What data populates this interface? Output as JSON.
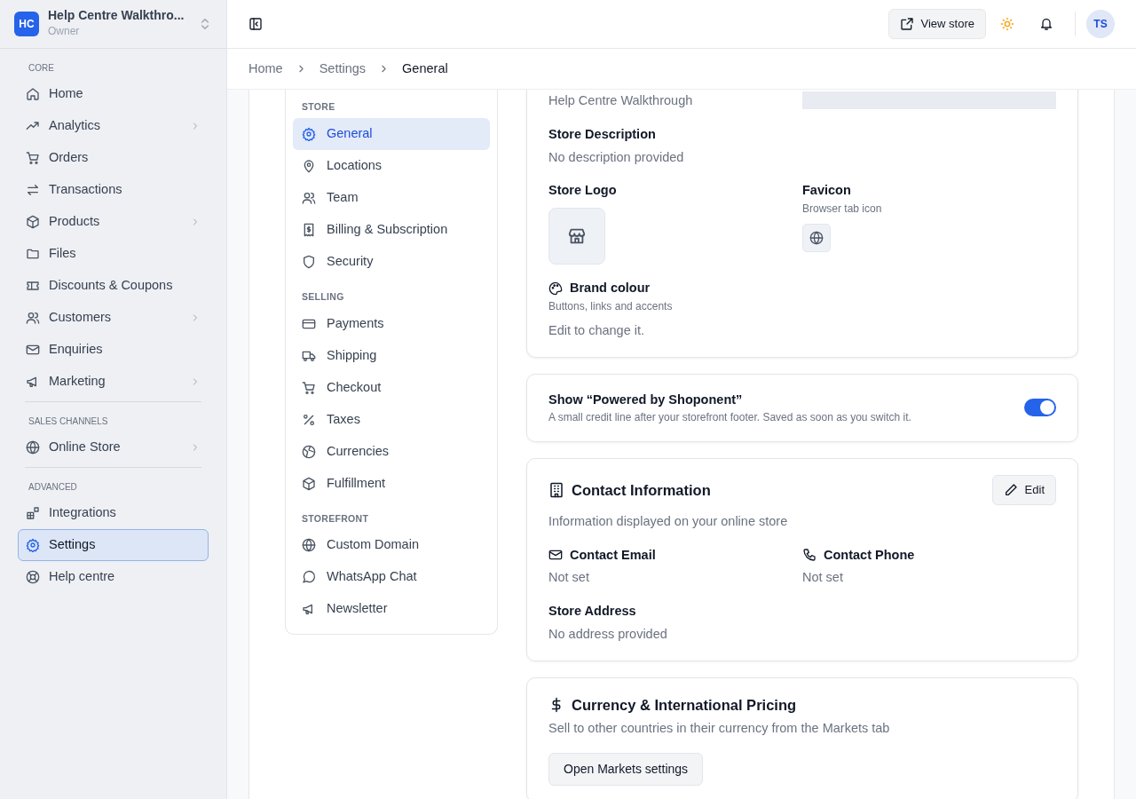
{
  "store_switcher": {
    "initials": "HC",
    "name": "Help Centre Walkthro...",
    "role": "Owner"
  },
  "sidebar": {
    "sections": [
      {
        "title": "CORE",
        "items": [
          {
            "label": "Home",
            "has_children": false,
            "selected": false
          },
          {
            "label": "Analytics",
            "has_children": true,
            "selected": false
          },
          {
            "label": "Orders",
            "has_children": false,
            "selected": false
          },
          {
            "label": "Transactions",
            "has_children": false,
            "selected": false
          },
          {
            "label": "Products",
            "has_children": true,
            "selected": false
          },
          {
            "label": "Files",
            "has_children": false,
            "selected": false
          },
          {
            "label": "Discounts & Coupons",
            "has_children": false,
            "selected": false
          },
          {
            "label": "Customers",
            "has_children": true,
            "selected": false
          },
          {
            "label": "Enquiries",
            "has_children": false,
            "selected": false
          },
          {
            "label": "Marketing",
            "has_children": true,
            "selected": false
          }
        ]
      },
      {
        "title": "SALES CHANNELS",
        "items": [
          {
            "label": "Online Store",
            "has_children": true,
            "selected": false
          }
        ]
      },
      {
        "title": "ADVANCED",
        "items": [
          {
            "label": "Integrations",
            "has_children": false,
            "selected": false
          },
          {
            "label": "Settings",
            "has_children": false,
            "selected": true
          },
          {
            "label": "Help centre",
            "has_children": false,
            "selected": false
          }
        ]
      }
    ]
  },
  "topbar": {
    "view_store": "View store",
    "avatar": "TS"
  },
  "breadcrumb": [
    "Home",
    "Settings",
    "General"
  ],
  "settings_nav": [
    {
      "title": "STORE",
      "items": [
        {
          "label": "General",
          "selected": true
        },
        {
          "label": "Locations",
          "selected": false
        },
        {
          "label": "Team",
          "selected": false
        },
        {
          "label": "Billing & Subscription",
          "selected": false
        },
        {
          "label": "Security",
          "selected": false
        }
      ]
    },
    {
      "title": "SELLING",
      "items": [
        {
          "label": "Payments",
          "selected": false
        },
        {
          "label": "Shipping",
          "selected": false
        },
        {
          "label": "Checkout",
          "selected": false
        },
        {
          "label": "Taxes",
          "selected": false
        },
        {
          "label": "Currencies",
          "selected": false
        },
        {
          "label": "Fulfillment",
          "selected": false
        }
      ]
    },
    {
      "title": "STOREFRONT",
      "items": [
        {
          "label": "Custom Domain",
          "selected": false
        },
        {
          "label": "WhatsApp Chat",
          "selected": false
        },
        {
          "label": "Newsletter",
          "selected": false
        }
      ]
    }
  ],
  "store_card": {
    "store_name": "Help Centre Walkthrough",
    "description_label": "Store Description",
    "description": "No description provided",
    "logo_label": "Store Logo",
    "favicon_label": "Favicon",
    "favicon_hint": "Browser tab icon",
    "brand_label": "Brand colour",
    "brand_hint": "Buttons, links and accents",
    "brand_note": "Edit to change it."
  },
  "powered_by": {
    "title": "Show “Powered by Shoponent”",
    "description": "A small credit line after your storefront footer. Saved as soon as you switch it.",
    "on": true
  },
  "contact_card": {
    "title": "Contact Information",
    "edit": "Edit",
    "subtitle": "Information displayed on your online store",
    "email_label": "Contact Email",
    "email": "Not set",
    "phone_label": "Contact Phone",
    "phone": "Not set",
    "address_label": "Store Address",
    "address": "No address provided"
  },
  "currency_card": {
    "title": "Currency & International Pricing",
    "subtitle": "Sell to other countries in their currency from the Markets tab",
    "button": "Open Markets settings"
  }
}
